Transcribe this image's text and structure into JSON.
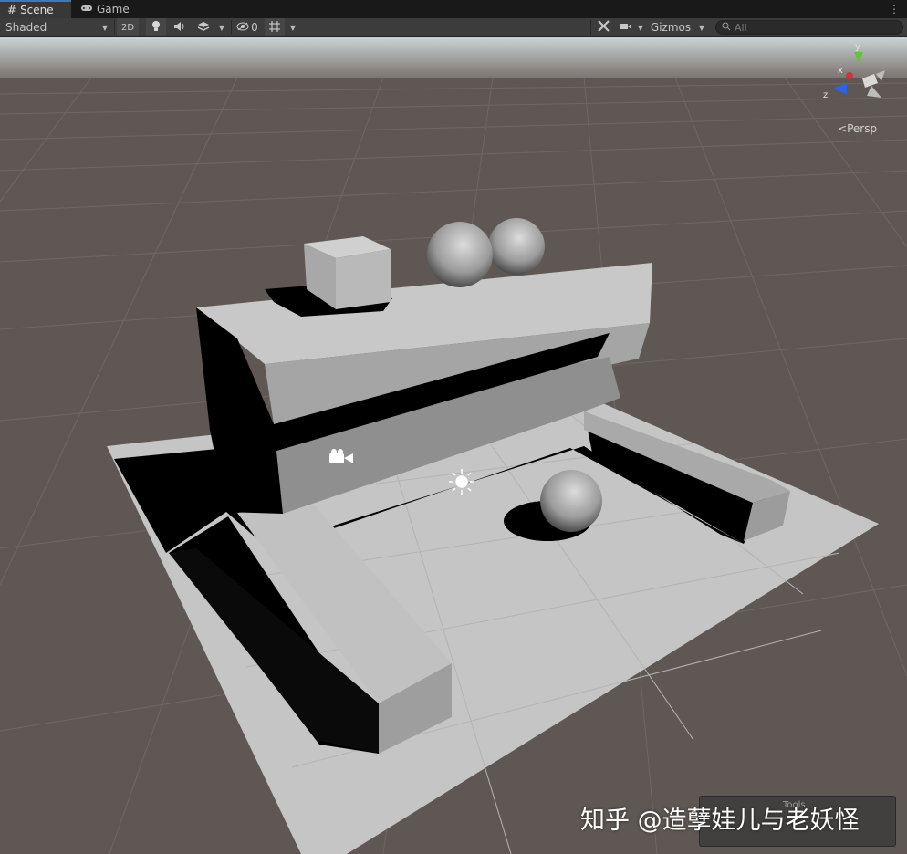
{
  "tabs": [
    {
      "label": "Scene",
      "icon": "grid-icon",
      "active": true
    },
    {
      "label": "Game",
      "icon": "gamepad-icon",
      "active": false
    }
  ],
  "toolbar": {
    "draw_mode": "Shaded",
    "mode_2d": "2D",
    "hidden_count": "0",
    "gizmos": "Gizmos",
    "search_placeholder": "All"
  },
  "gizmo": {
    "axis_x": "x",
    "axis_y": "y",
    "axis_z": "z",
    "projection": "Persp",
    "colors": {
      "x": "#d0333d",
      "y": "#63c13c",
      "z": "#2e63e0"
    }
  },
  "overlay": {
    "title": "Tools"
  },
  "watermark": "知乎 @造孽娃儿与老妖怪",
  "scene_colors": {
    "sky": "#c9d2d6",
    "ground": "#5f5753",
    "plane": "#c4c4c4",
    "shadow": "#000000"
  }
}
